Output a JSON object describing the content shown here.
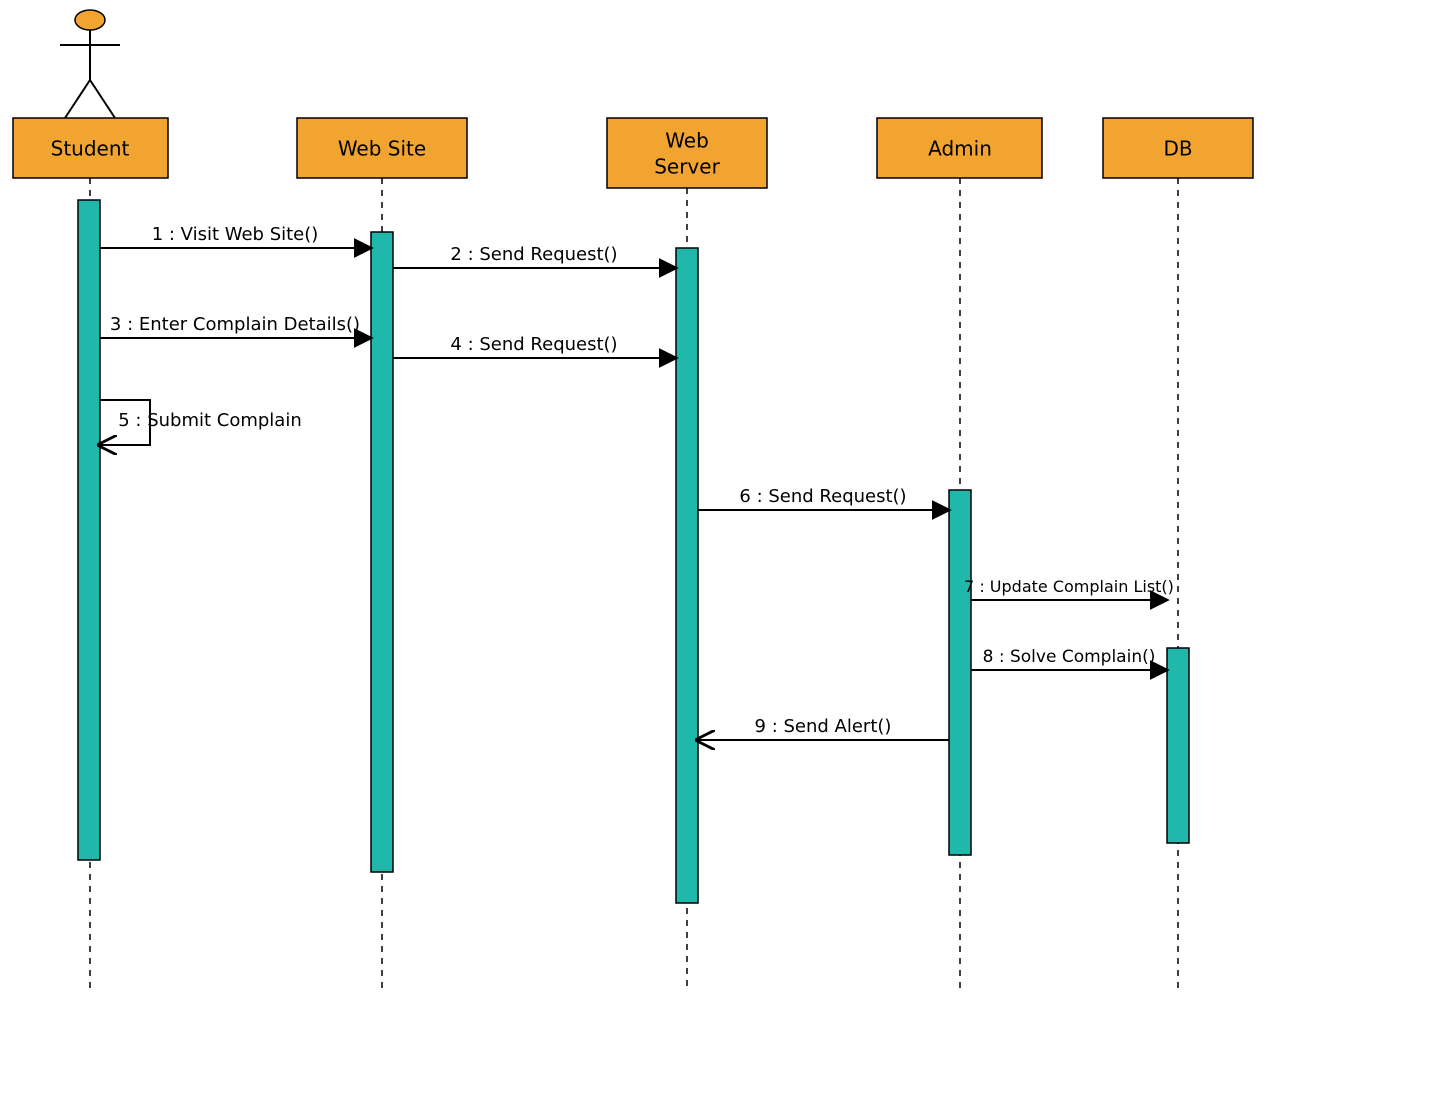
{
  "diagram": {
    "type": "uml-sequence",
    "lifelines": [
      {
        "id": "student",
        "label": "Student",
        "actor": true
      },
      {
        "id": "website",
        "label": "Web Site",
        "actor": false
      },
      {
        "id": "webserver",
        "label": "Web Server",
        "actor": false
      },
      {
        "id": "admin",
        "label": "Admin",
        "actor": false
      },
      {
        "id": "db",
        "label": "DB",
        "actor": false
      }
    ],
    "messages": [
      {
        "id": "m1",
        "from": "student",
        "to": "website",
        "label": "1 : Visit Web Site()"
      },
      {
        "id": "m2",
        "from": "website",
        "to": "webserver",
        "label": "2 : Send Request()"
      },
      {
        "id": "m3",
        "from": "student",
        "to": "website",
        "label": "3 : Enter Complain Details()"
      },
      {
        "id": "m4",
        "from": "website",
        "to": "webserver",
        "label": "4 : Send Request()"
      },
      {
        "id": "m5",
        "from": "student",
        "to": "student",
        "label": "5 : Submit Complain"
      },
      {
        "id": "m6",
        "from": "webserver",
        "to": "admin",
        "label": "6 : Send Request()"
      },
      {
        "id": "m7",
        "from": "admin",
        "to": "db",
        "label": "7 : Update Complain List()"
      },
      {
        "id": "m8",
        "from": "admin",
        "to": "db",
        "label": "8 : Solve Complain()"
      },
      {
        "id": "m9",
        "from": "admin",
        "to": "webserver",
        "label": "9 : Send Alert()"
      }
    ],
    "colors": {
      "lifeline_fill": "#f2a431",
      "activation_fill": "#20b8ab",
      "line": "#000000"
    }
  }
}
